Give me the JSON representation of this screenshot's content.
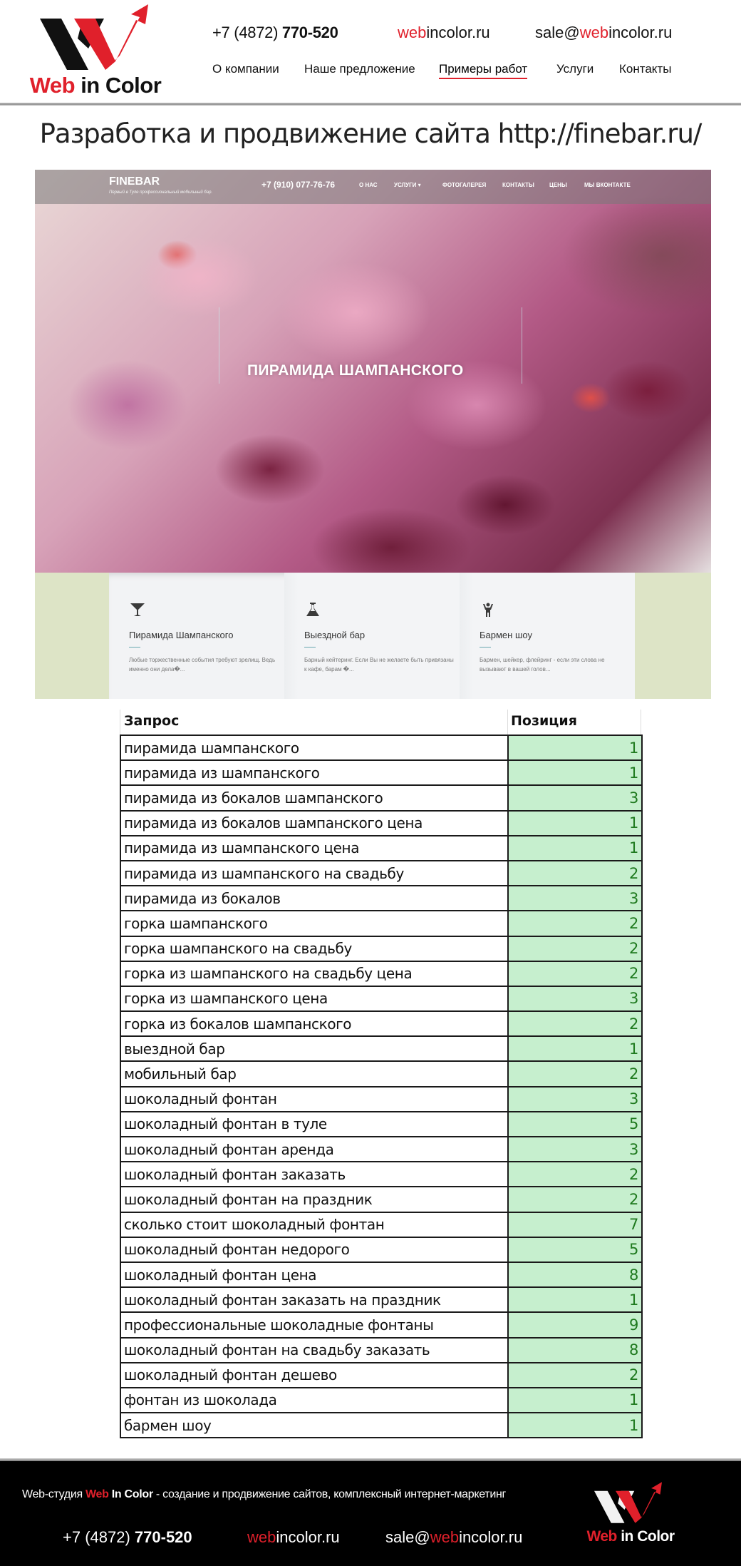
{
  "brand": {
    "name_part1": "Web",
    "name_part2": " in Color",
    "accent_color": "#e0202b"
  },
  "header": {
    "phone_prefix": "+7 (4872) ",
    "phone_number": "770-520",
    "site_red": "web",
    "site_rest": "incolor.ru",
    "email_prefix": "sale@",
    "email_red": "web",
    "email_rest": "incolor.ru",
    "nav": [
      {
        "label": "О компании",
        "active": false
      },
      {
        "label": "Наше предложение",
        "active": false
      },
      {
        "label": "Примеры работ",
        "active": true
      },
      {
        "label": "Услуги",
        "active": false
      },
      {
        "label": "Контакты",
        "active": false
      }
    ]
  },
  "page_title": "Разработка и продвижение сайта http://finebar.ru/",
  "site_screenshot": {
    "logo": "FINEBAR",
    "tagline": "Первый в Туле профессиональный мобильный бар.",
    "phone": "+7 (910) 077-76-76",
    "nav": [
      "О НАС",
      "УСЛУГИ ▾",
      "ФОТОГАЛЕРЕЯ",
      "КОНТАКТЫ",
      "ЦЕНЫ",
      "МЫ ВКОНТАКТЕ"
    ],
    "hero_heading": "ПИРАМИДА ШАМПАНСКОГО",
    "cards": [
      {
        "icon": "cocktail-glass-icon",
        "title": "Пирамида Шампанского",
        "text": "Любые торжественные события требуют зрелищ. Ведь именно они дела�..."
      },
      {
        "icon": "flask-icon",
        "title": "Выездной бар",
        "text": "Барный кейтеринг. Если Вы не желаете быть привязаны к кафе, барам �..."
      },
      {
        "icon": "person-icon",
        "title": "Бармен шоу",
        "text": "Бармен, шейкер, флейринг - если эти слова не вызывают в вашей голов..."
      }
    ]
  },
  "rankings": {
    "headers": {
      "query": "Запрос",
      "position": "Позиция"
    },
    "rows": [
      {
        "query": "пирамида шампанского",
        "position": "1"
      },
      {
        "query": "пирамида из шампанского",
        "position": "1"
      },
      {
        "query": "пирамида из бокалов шампанского",
        "position": "3"
      },
      {
        "query": "пирамида из бокалов шампанского цена",
        "position": "1"
      },
      {
        "query": "пирамида из шампанского цена",
        "position": "1"
      },
      {
        "query": "пирамида из шампанского на свадьбу",
        "position": "2"
      },
      {
        "query": "пирамида из бокалов",
        "position": "3"
      },
      {
        "query": "горка шампанского",
        "position": "2"
      },
      {
        "query": "горка шампанского на свадьбу",
        "position": "2"
      },
      {
        "query": "горка из шампанского на свадьбу цена",
        "position": "2"
      },
      {
        "query": "горка из шампанского цена",
        "position": "3"
      },
      {
        "query": "горка из бокалов шампанского",
        "position": "2"
      },
      {
        "query": "выездной бар",
        "position": "1"
      },
      {
        "query": "мобильный бар",
        "position": "2"
      },
      {
        "query": "шоколадный фонтан",
        "position": "3"
      },
      {
        "query": "шоколадный фонтан в туле",
        "position": "5"
      },
      {
        "query": "шоколадный фонтан аренда",
        "position": "3"
      },
      {
        "query": "шоколадный фонтан заказать",
        "position": "2"
      },
      {
        "query": "шоколадный фонтан на праздник",
        "position": "2"
      },
      {
        "query": "сколько стоит шоколадный фонтан",
        "position": "7"
      },
      {
        "query": "шоколадный фонтан недорого",
        "position": "5"
      },
      {
        "query": "шоколадный фонтан цена",
        "position": "8"
      },
      {
        "query": "шоколадный фонтан заказать на праздник",
        "position": "1"
      },
      {
        "query": "профессиональные шоколадные фонтаны",
        "position": "9"
      },
      {
        "query": "шоколадный фонтан на свадьбу заказать",
        "position": "8"
      },
      {
        "query": "шоколадный фонтан дешево",
        "position": "2"
      },
      {
        "query": "фонтан из шоколада",
        "position": "1"
      },
      {
        "query": "бармен шоу",
        "position": "1"
      }
    ]
  },
  "footer": {
    "tagline_prefix": "Web-студия ",
    "tagline_red": "Web",
    "tagline_bold": " In Color",
    "tagline_rest": " - создание и продвижение сайтов, комплексный интернет-маркетинг",
    "phone_prefix": "+7 (4872) ",
    "phone_number": "770-520",
    "site_red": "web",
    "site_rest": "incolor.ru",
    "email_prefix": "sale@",
    "email_red": "web",
    "email_rest": "incolor.ru",
    "logo_part1": "Web",
    "logo_part2": " in Color"
  }
}
